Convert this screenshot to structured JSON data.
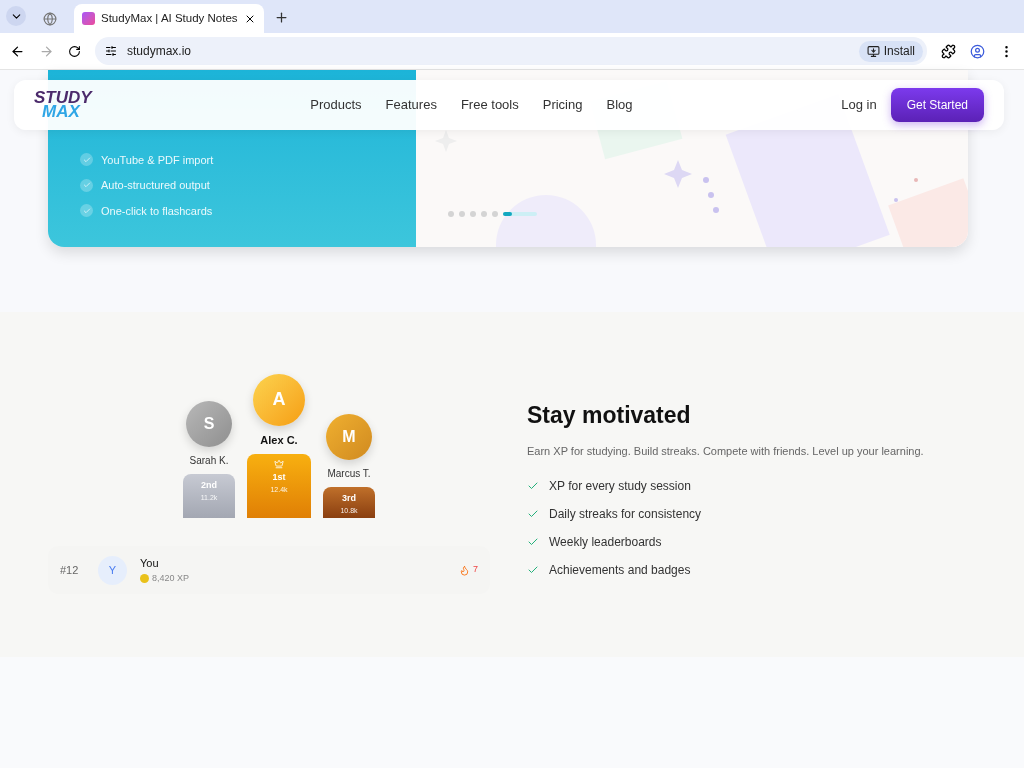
{
  "browser": {
    "tabs": [
      {
        "kind": "globe",
        "selected": false
      },
      {
        "title": "StudyMax | AI Study Notes",
        "kind": "site",
        "selected": true
      }
    ],
    "url": "studymax.io",
    "install": "Install"
  },
  "nav": {
    "logo": [
      "STUDY",
      "MAX"
    ],
    "links": [
      "Products",
      "Features",
      "Free tools",
      "Pricing",
      "Blog"
    ],
    "login": "Log in",
    "cta": "Get Started"
  },
  "hero": {
    "features": [
      "YouTube & PDF import",
      "Auto-structured output",
      "One-click to flashcards"
    ],
    "slides": [
      {
        "selected": false
      },
      {
        "selected": false
      },
      {
        "selected": false
      },
      {
        "selected": false
      },
      {
        "selected": false
      },
      {
        "selected": true
      }
    ]
  },
  "podium": [
    {
      "initial": "S",
      "name": "Sarah K.",
      "place": "2nd",
      "xp": "11.2k",
      "kind": "silver"
    },
    {
      "initial": "A",
      "name": "Alex C.",
      "place": "1st",
      "xp": "12.4k",
      "kind": "gold"
    },
    {
      "initial": "M",
      "name": "Marcus T.",
      "place": "3rd",
      "xp": "10.8k",
      "kind": "bronze"
    }
  ],
  "you": {
    "rank": "#12",
    "initial": "Y",
    "name": "You",
    "xp": "8,420 XP",
    "streak": "7"
  },
  "motivation": {
    "title": "Stay motivated",
    "subtitle": "Earn XP for studying. Build streaks. Compete with friends. Level up your learning.",
    "items": [
      "XP for every study session",
      "Daily streaks for consistency",
      "Weekly leaderboards",
      "Achievements and badges"
    ]
  }
}
